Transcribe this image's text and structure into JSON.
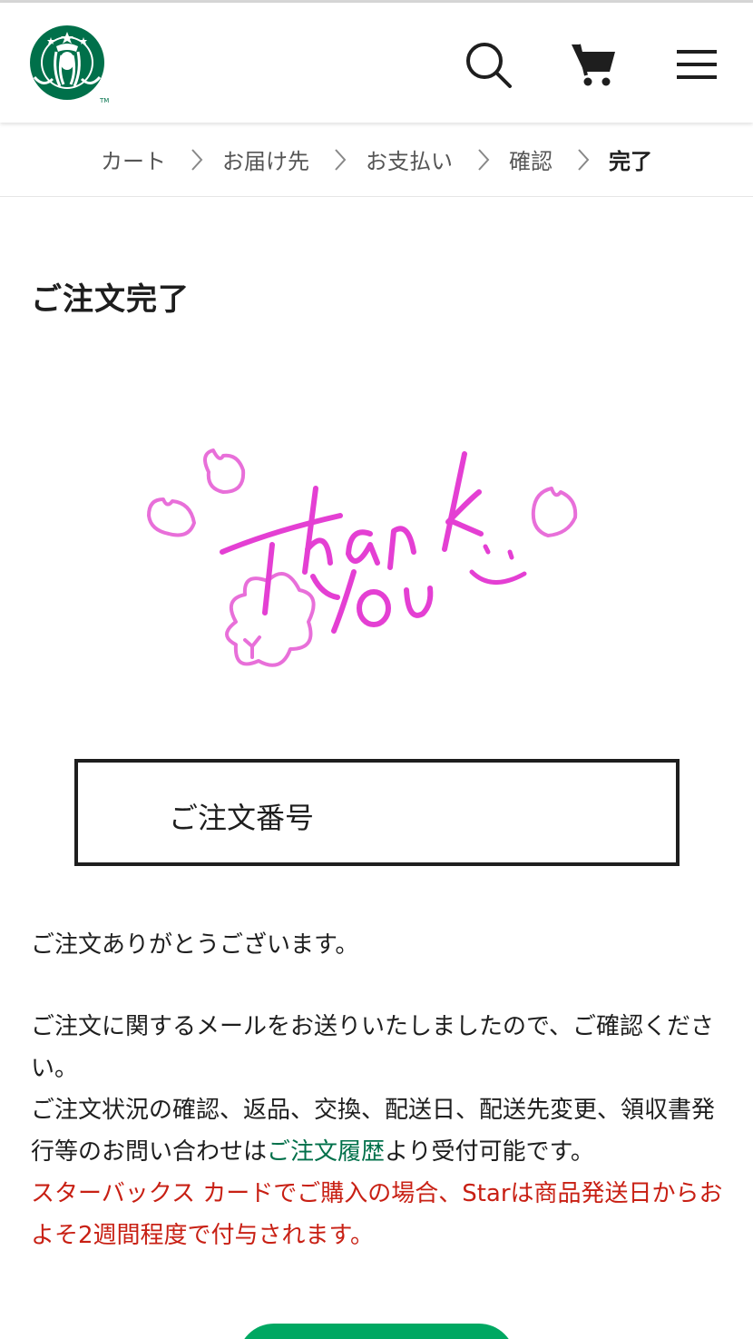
{
  "header": {
    "logo_icon": "starbucks-siren-logo",
    "search_icon": "search-icon",
    "cart_icon": "cart-icon",
    "menu_icon": "hamburger-menu-icon"
  },
  "breadcrumb": {
    "steps": [
      {
        "label": "カート"
      },
      {
        "label": "お届け先"
      },
      {
        "label": "お支払い"
      },
      {
        "label": "確認"
      },
      {
        "label": "完了"
      }
    ],
    "active_step": "完了"
  },
  "page": {
    "title": "ご注文完了"
  },
  "order_box": {
    "label": "ご注文番号",
    "number": ""
  },
  "message": {
    "thanks": "ご注文ありがとうございます。",
    "email_note": "ご注文に関するメールをお送りいたしましたので、ご確認ください。",
    "inquiry_before": "ご注文状況の確認、返品、交換、配送日、配送先変更、領収書発行等のお問い合わせは",
    "inquiry_link": "ご注文履歴",
    "inquiry_after": "より受付可能です。",
    "star_note": "スターバックス カードでご購入の場合、Starは商品発送日からおよそ2週間程度で付与されます。"
  },
  "colors": {
    "brand_green": "#00704a",
    "button_green": "#00a862",
    "notice_red": "#c82014",
    "thanks_pink": "#e43fd3"
  }
}
